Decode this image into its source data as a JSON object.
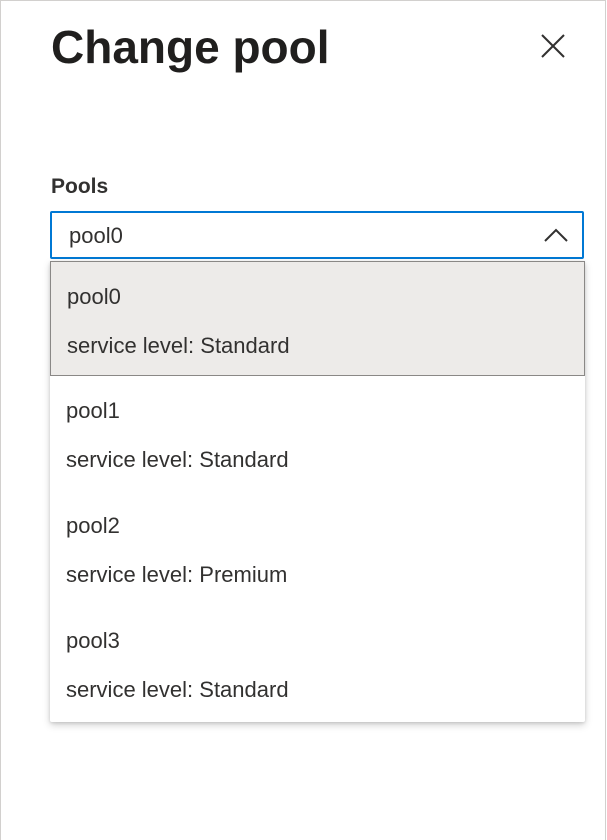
{
  "panel": {
    "title": "Change pool",
    "close_icon": "close-icon"
  },
  "pools_field": {
    "label": "Pools",
    "selected_value": "pool0",
    "toggle_icon": "chevron-up-icon",
    "accent_color": "#0078d4"
  },
  "options": [
    {
      "name": "pool0",
      "service_level": "service level: Standard",
      "selected": true
    },
    {
      "name": "pool1",
      "service_level": "service level: Standard",
      "selected": false
    },
    {
      "name": "pool2",
      "service_level": "service level: Premium",
      "selected": false
    },
    {
      "name": "pool3",
      "service_level": "service level: Standard",
      "selected": false
    }
  ]
}
